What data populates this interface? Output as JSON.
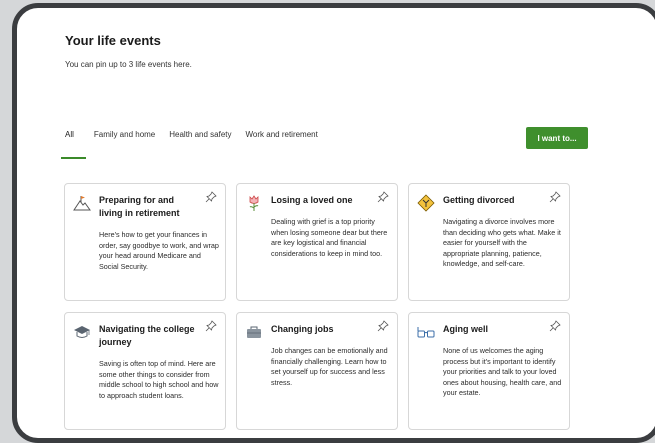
{
  "page": {
    "title": "Your life events",
    "subtitle": "You can pin up to 3 life events here."
  },
  "tabs": [
    {
      "label": "All",
      "active": true
    },
    {
      "label": "Family and home",
      "active": false
    },
    {
      "label": "Health and safety",
      "active": false
    },
    {
      "label": "Work and retirement",
      "active": false
    }
  ],
  "cta": {
    "label": "I want to..."
  },
  "cards": [
    {
      "title": "Preparing for and living in retirement",
      "icon": "flag-mountain-icon",
      "description": "Here's how to get your finances in order, say goodbye to work, and wrap your head around Medicare and Social Security."
    },
    {
      "title": "Losing a loved one",
      "icon": "tulip-icon",
      "description": "Dealing with grief is a top priority when losing someone dear but there are key logistical and financial considerations to keep in mind too."
    },
    {
      "title": "Getting divorced",
      "icon": "diverging-road-sign-icon",
      "description": "Navigating a divorce involves more than deciding who gets what. Make it easier for yourself with the appropriate planning, patience, knowledge, and self-care."
    },
    {
      "title": "Navigating the college journey",
      "icon": "graduation-cap-icon",
      "description": "Saving is often top of mind. Here are some other things to consider from middle school to high school and how to approach student loans."
    },
    {
      "title": "Changing jobs",
      "icon": "briefcase-icon",
      "description": "Job changes can be emotionally and financially challenging. Learn how to set yourself up for success and less stress."
    },
    {
      "title": "Aging well",
      "icon": "eyeglasses-icon",
      "description": "None of us welcomes the aging process but it's important to identify your priorities and talk to your loved ones about housing, health care, and your estate."
    }
  ],
  "colors": {
    "accent": "#3f8f2d",
    "frame": "#3b3d40",
    "background": "#d5d7d9"
  }
}
